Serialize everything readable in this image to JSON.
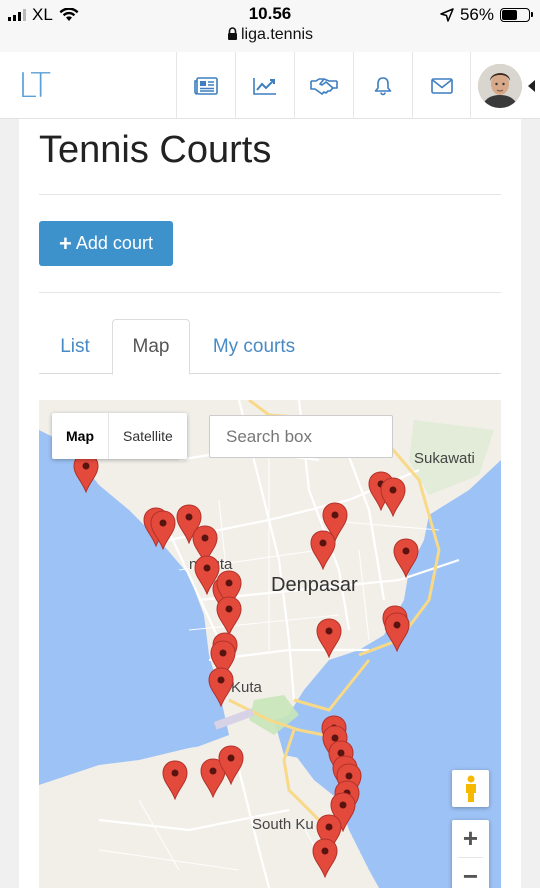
{
  "status": {
    "carrier": "XL",
    "time": "10.56",
    "url": "liga.tennis",
    "battery": "56%",
    "battery_level": 0.56
  },
  "header": {
    "logo": "LT",
    "nav": [
      {
        "icon": "newspaper-icon"
      },
      {
        "icon": "chart-line-icon"
      },
      {
        "icon": "handshake-icon"
      },
      {
        "icon": "bell-icon"
      },
      {
        "icon": "envelope-icon"
      }
    ]
  },
  "page": {
    "title": "Tennis Courts",
    "add_label": "Add court",
    "tabs": [
      "List",
      "Map",
      "My courts"
    ],
    "active_tab": "Map"
  },
  "map": {
    "type_map": "Map",
    "type_satellite": "Satellite",
    "search_placeholder": "Search box",
    "labels": [
      "Sukawati",
      "Denpasar",
      "Kuta",
      "South Ku"
    ],
    "labels_partial": [
      "n Kuta"
    ],
    "zoom_in": "+",
    "zoom_out": "−",
    "colors": {
      "water": "#9dc2f5",
      "land": "#f2efe9",
      "pin": "#e34a3c",
      "road": "#ffffff",
      "highway": "#f8d987"
    }
  }
}
